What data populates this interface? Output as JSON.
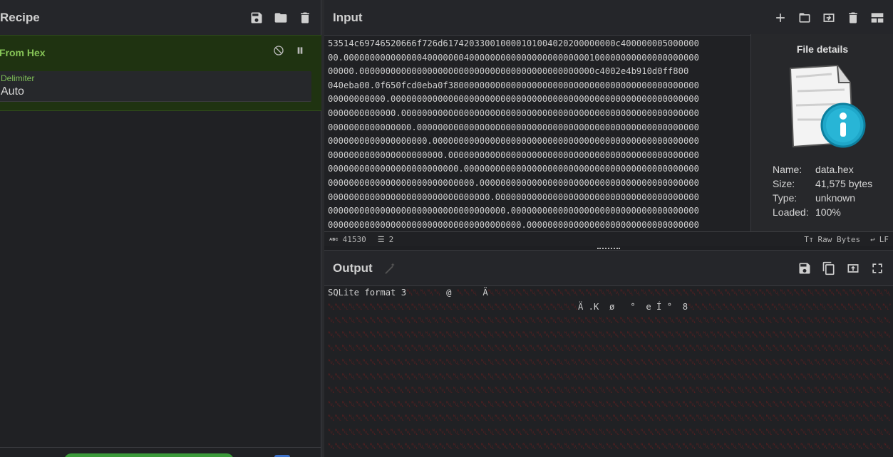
{
  "recipe": {
    "title": "Recipe",
    "operation": {
      "name": "From Hex",
      "arg_label": "Delimiter",
      "arg_value": "Auto"
    }
  },
  "input": {
    "title": "Input",
    "lines": [
      "53514c69746520666f726d617420330010000101004020200000000c400000005000000",
      "00.00000000000000040000000400000000000000000000000100000000000000000000",
      "00000.000000000000000000000000000000000000000000000c4002e4b910d0ff800",
      "040eba00.0f650fcd0eba0f380000000000000000000000000000000000000000000000",
      "00000000000.00000000000000000000000000000000000000000000000000000000000",
      "0000000000000.000000000000000000000000000000000000000000000000000000000",
      "0000000000000000.000000000000000000000000000000000000000000000000000000",
      "0000000000000000000.000000000000000000000000000000000000000000000000000",
      "0000000000000000000000.000000000000000000000000000000000000000000000000",
      "0000000000000000000000000.000000000000000000000000000000000000000000000",
      "0000000000000000000000000000.000000000000000000000000000000000000000000",
      "0000000000000000000000000000000.000000000000000000000000000000000000000",
      "0000000000000000000000000000000000.000000000000000000000000000000000000",
      "0000000000000000000000000000000000000.000000000000000000000000000000000"
    ],
    "status": {
      "length": "41530",
      "lines": "2",
      "encoding": "Raw Bytes",
      "eol": "LF"
    }
  },
  "file_details": {
    "title": "File details",
    "name_label": "Name:",
    "name": "data.hex",
    "size_label": "Size:",
    "size": "41,575 bytes",
    "type_label": "Type:",
    "type": "unknown",
    "loaded_label": "Loaded:",
    "loaded": "100%"
  },
  "output": {
    "title": "Output",
    "line1_text": "SQLite format 3",
    "line1_at": "@",
    "line1_a": "Ä",
    "line2_text": "Ä .K  ø   °  e Í °  8"
  },
  "colors": {
    "accent_green": "#86c457",
    "operation_bg": "#1f3311",
    "nonprintable_red": "#7a1f1f"
  }
}
